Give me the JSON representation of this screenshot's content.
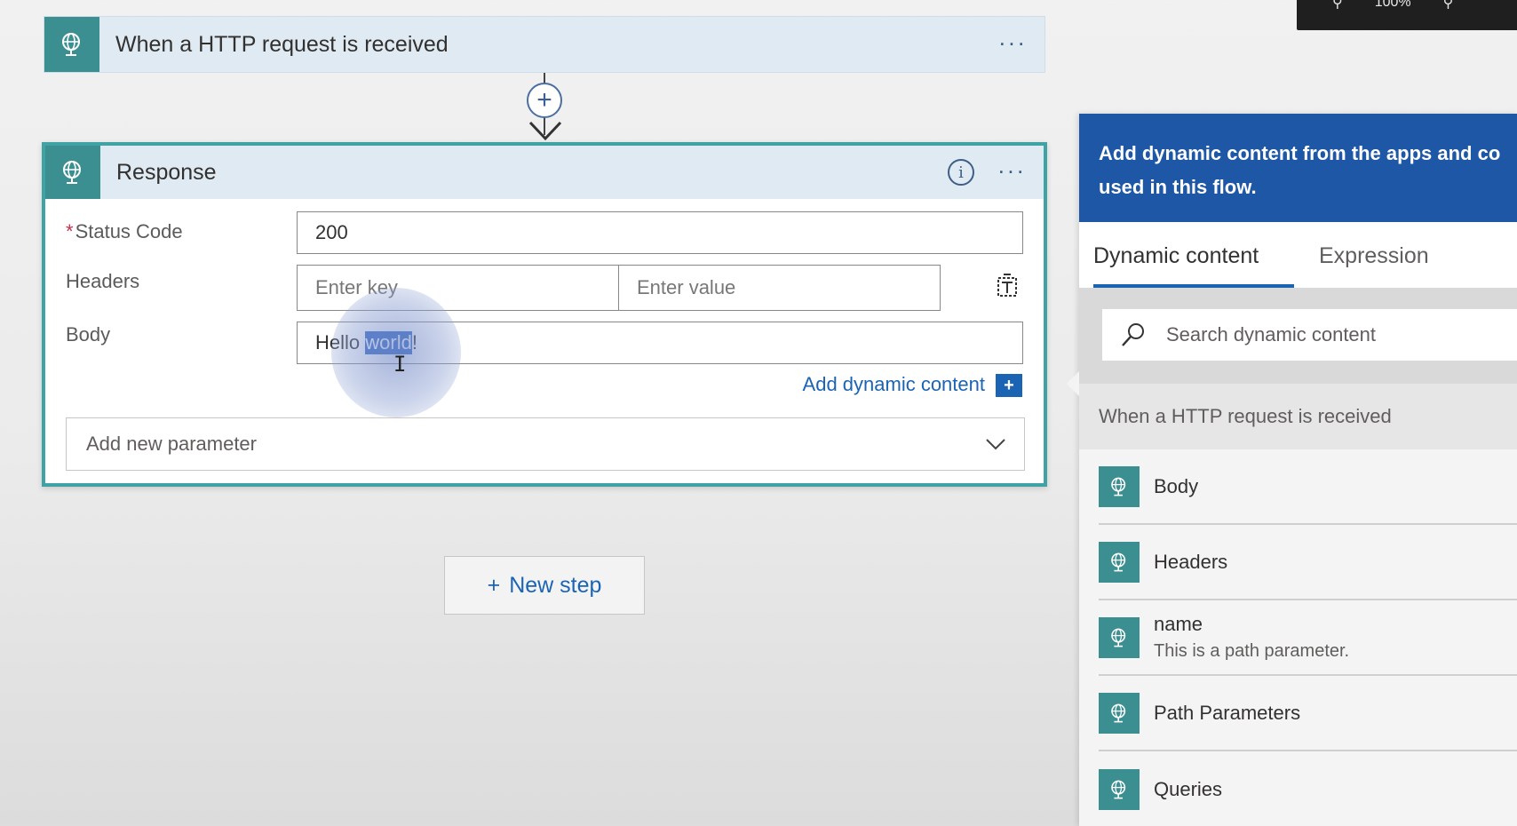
{
  "zoom": {
    "text": "100%"
  },
  "trigger": {
    "title": "When a HTTP request is received",
    "more": "···"
  },
  "connector": {
    "add_symbol": "+"
  },
  "response": {
    "title": "Response",
    "info_symbol": "i",
    "more": "···",
    "status_code": {
      "label": "Status Code",
      "required": "*",
      "value": "200"
    },
    "headers": {
      "label": "Headers",
      "key_placeholder": "Enter key",
      "value_placeholder": "Enter value"
    },
    "body": {
      "label": "Body",
      "before": "Hello ",
      "selected": "world",
      "after": "!"
    },
    "add_dynamic": {
      "label": "Add dynamic content",
      "symbol": "+"
    },
    "add_param": {
      "label": "Add new parameter"
    }
  },
  "new_step": {
    "symbol": "+",
    "label": "New step"
  },
  "dynamic_panel": {
    "banner_line1": "Add dynamic content from the apps and co",
    "banner_line2": "used in this flow.",
    "tabs": {
      "dynamic": "Dynamic content",
      "expression": "Expression"
    },
    "search_placeholder": "Search dynamic content",
    "section": "When a HTTP request is received",
    "items": [
      {
        "name": "Body",
        "desc": ""
      },
      {
        "name": "Headers",
        "desc": ""
      },
      {
        "name": "name",
        "desc": "This is a path parameter."
      },
      {
        "name": "Path Parameters",
        "desc": ""
      },
      {
        "name": "Queries",
        "desc": ""
      }
    ]
  },
  "colors": {
    "connector_teal": "#3b8f91",
    "accent_blue": "#1b64b4",
    "banner_blue": "#1d57a6",
    "selection": "#2f68c5"
  }
}
